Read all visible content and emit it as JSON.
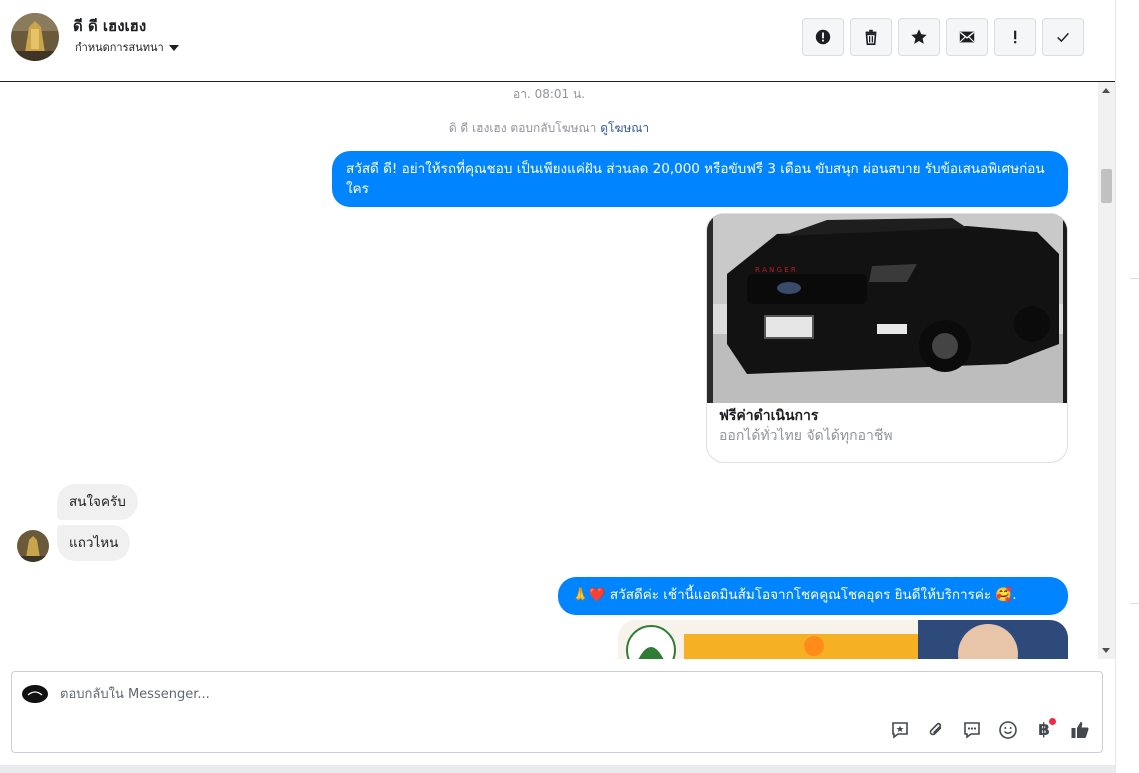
{
  "header": {
    "contact_name": "ดี ดี เฮงเฮง",
    "assign_label": "กำหนดการสนทนา"
  },
  "actions": [
    {
      "name": "report-spam",
      "icon": "alert-circle-icon"
    },
    {
      "name": "delete",
      "icon": "trash-icon"
    },
    {
      "name": "star",
      "icon": "star-icon"
    },
    {
      "name": "mark-unread",
      "icon": "envelope-icon"
    },
    {
      "name": "mark-important",
      "icon": "exclamation-icon"
    },
    {
      "name": "mark-done",
      "icon": "check-icon"
    }
  ],
  "thread": {
    "timestamp": "อา. 08:01 น.",
    "ad_reply_prefix": "ดิ ดี เฮงเฮง ตอบกลับโฆษณา ",
    "ad_reply_link": "ดูโฆษณา",
    "messages": [
      {
        "dir": "out",
        "text": "สวัสดี ดี! อย่าให้รถที่คุณชอบ เป็นเพียงแค่ฝัน ส่วนลด 20,000 หรือขับฟรี 3 เดือน ขับสนุก ผ่อนสบาย รับข้อเสนอพิเศษก่อนใคร"
      },
      {
        "dir": "in",
        "text": "สนใจครับ"
      },
      {
        "dir": "in",
        "text": "แถวไหน"
      },
      {
        "dir": "out",
        "text": "🙏❤️ สวัสดีค่ะ เช้านี้แอดมินส้มโอจากโชคคูณโชคอุดร ยินดีให้บริการค่ะ 🥰."
      }
    ],
    "card": {
      "title": "ฟรีค่าดำเนินการ",
      "subtitle": "ออกได้ทั่วไทย จัดได้ทุกอาชีพ"
    }
  },
  "composer": {
    "placeholder": "ตอบกลับใน Messenger...",
    "tools": [
      "saved-reply-icon",
      "paperclip-icon",
      "chat-bubble-icon",
      "smiley-icon",
      "baht-icon",
      "thumbs-up-icon"
    ],
    "currency_symbol": "฿"
  },
  "colors": {
    "accent": "#0084ff",
    "bubble_in": "#f1f0f0",
    "link": "#385898"
  }
}
